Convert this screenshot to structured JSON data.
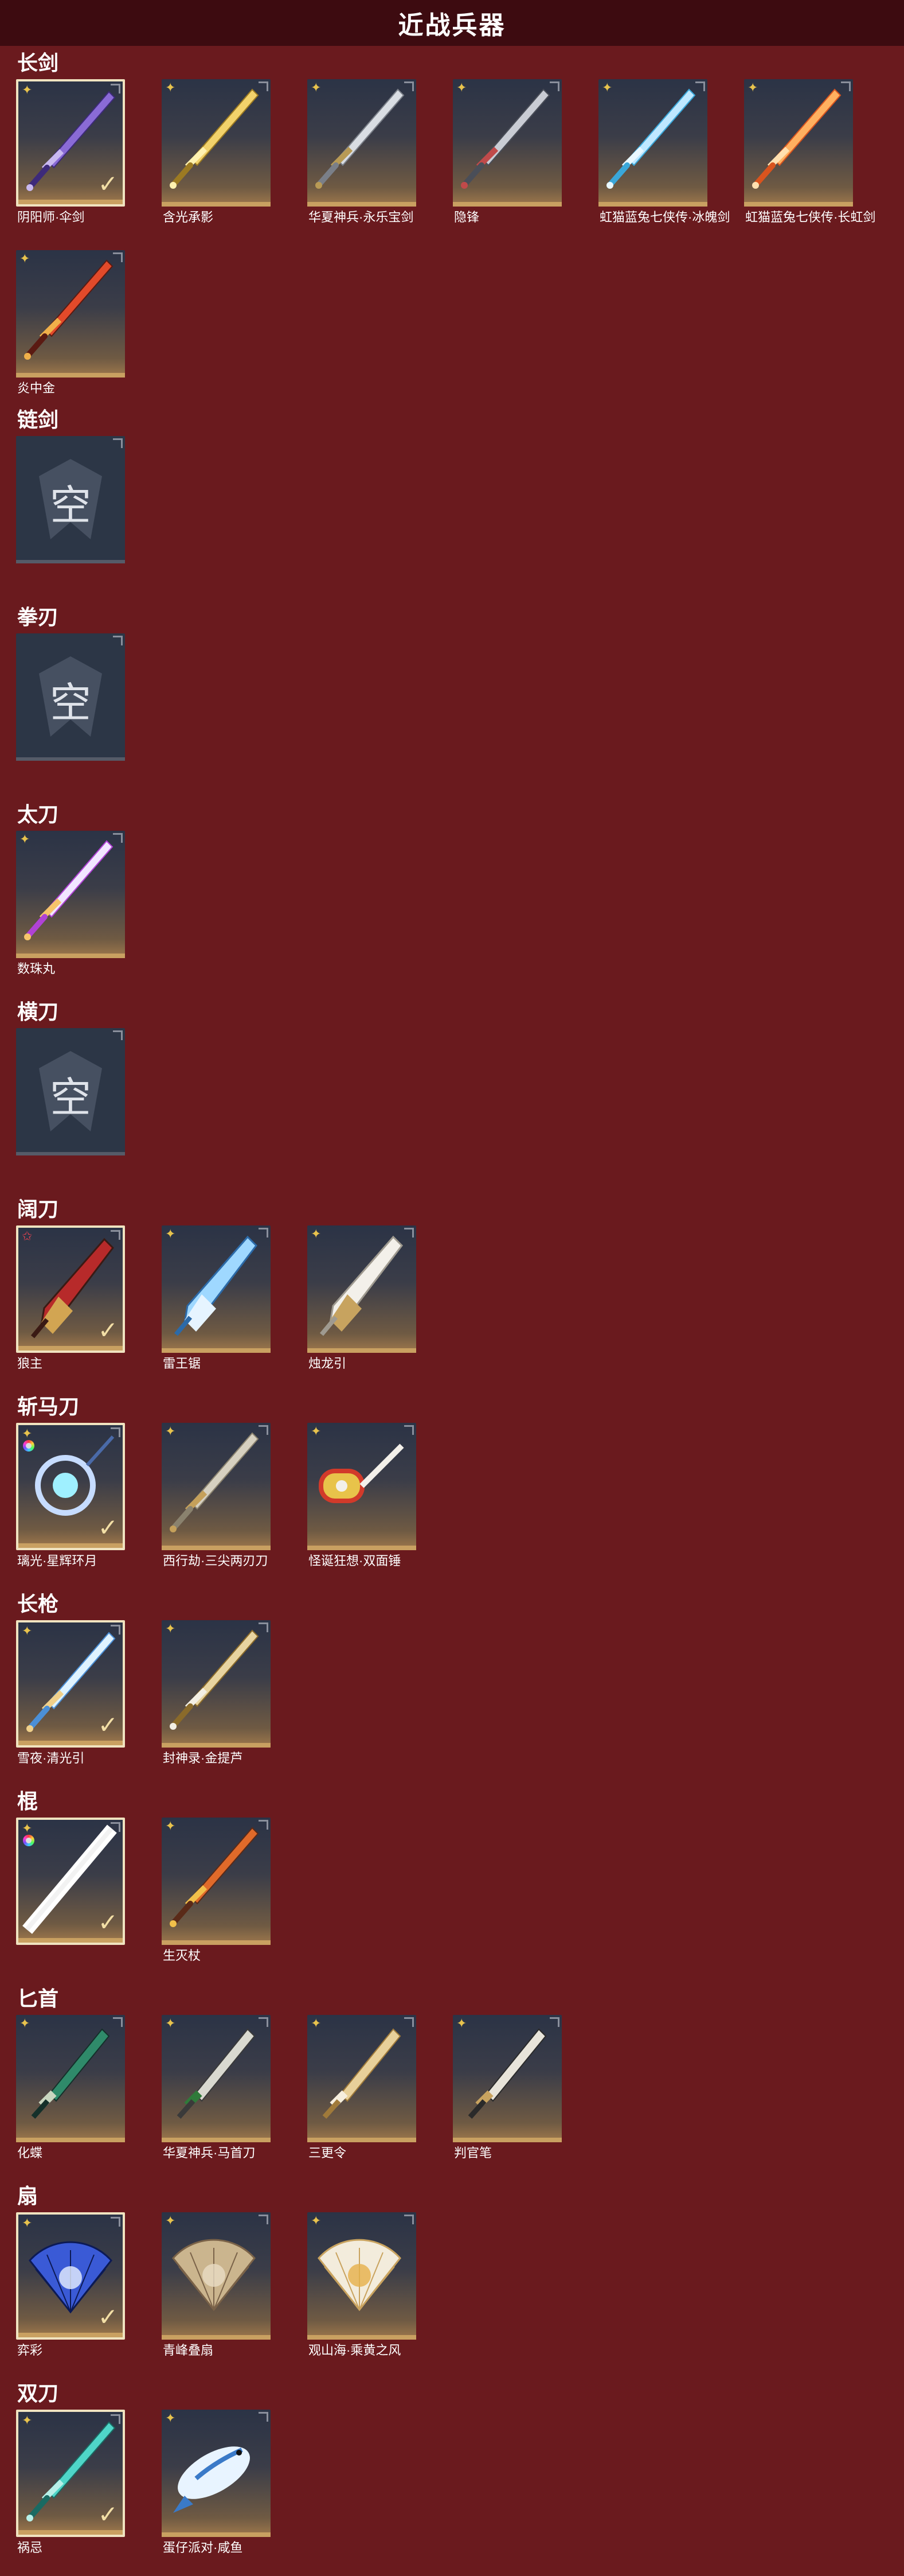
{
  "header": {
    "title": "近战兵器"
  },
  "sections": [
    {
      "title": "长剑",
      "items": [
        {
          "name": "阴阳师·伞剑",
          "selected": true,
          "rarity": "star",
          "weapon": "sword-purple"
        },
        {
          "name": "含光承影",
          "rarity": "star",
          "weapon": "sword-gold"
        },
        {
          "name": "华夏神兵·永乐宝剑",
          "rarity": "star",
          "weapon": "sword-silver"
        },
        {
          "name": "隐锋",
          "rarity": "star",
          "weapon": "sword-dark"
        },
        {
          "name": "虹猫蓝兔七侠传·冰魄剑",
          "rarity": "star",
          "weapon": "sword-ice"
        },
        {
          "name": "虹猫蓝兔七侠传·长虹剑",
          "rarity": "star",
          "weapon": "sword-orange"
        },
        {
          "name": "炎中金",
          "rarity": "star",
          "weapon": "sword-flame"
        }
      ]
    },
    {
      "title": "链剑",
      "items": [
        {
          "name": "",
          "empty": true,
          "empty_label": "空"
        }
      ]
    },
    {
      "title": "拳刃",
      "items": [
        {
          "name": "",
          "empty": true,
          "empty_label": "空"
        }
      ]
    },
    {
      "title": "太刀",
      "items": [
        {
          "name": "数珠丸",
          "rarity": "star",
          "weapon": "katana"
        }
      ]
    },
    {
      "title": "横刀",
      "items": [
        {
          "name": "",
          "empty": true,
          "empty_label": "空"
        }
      ]
    },
    {
      "title": "阔刀",
      "items": [
        {
          "name": "狼主",
          "selected": true,
          "rarity": "pink-star",
          "weapon": "broad-red"
        },
        {
          "name": "雷王锯",
          "rarity": "star",
          "weapon": "broad-blue"
        },
        {
          "name": "烛龙引",
          "rarity": "star",
          "weapon": "broad-white"
        }
      ]
    },
    {
      "title": "斩马刀",
      "items": [
        {
          "name": "璃光·星辉环月",
          "selected": true,
          "rarity": "star",
          "ring": true,
          "weapon": "moon-blade"
        },
        {
          "name": "西行劫·三尖两刃刀",
          "rarity": "star",
          "weapon": "trident"
        },
        {
          "name": "怪诞狂想·双面锤",
          "rarity": "star",
          "weapon": "hammer"
        }
      ]
    },
    {
      "title": "长枪",
      "items": [
        {
          "name": "雪夜·清光引",
          "selected": true,
          "rarity": "star",
          "weapon": "spear-ice"
        },
        {
          "name": "封神录·金提芦",
          "rarity": "star",
          "weapon": "spear-gold"
        }
      ]
    },
    {
      "title": "棍",
      "items": [
        {
          "name": "",
          "selected": true,
          "rarity": "star",
          "ring": true,
          "weapon": "staff-white"
        },
        {
          "name": "生灭杖",
          "rarity": "star",
          "weapon": "staff-flame"
        }
      ]
    },
    {
      "title": "匕首",
      "items": [
        {
          "name": "化蝶",
          "rarity": "star",
          "weapon": "dagger-jade"
        },
        {
          "name": "华夏神兵·马首刀",
          "rarity": "star",
          "weapon": "dagger-horse"
        },
        {
          "name": "三更令",
          "rarity": "star",
          "weapon": "dagger-gold"
        },
        {
          "name": "判官笔",
          "rarity": "star",
          "weapon": "brush"
        }
      ]
    },
    {
      "title": "扇",
      "items": [
        {
          "name": "弈彩",
          "selected": true,
          "rarity": "star",
          "weapon": "fan-blue"
        },
        {
          "name": "青峰叠扇",
          "rarity": "star",
          "weapon": "fan-wood"
        },
        {
          "name": "观山海·乘黄之风",
          "rarity": "star",
          "weapon": "fan-white"
        }
      ]
    },
    {
      "title": "双刀",
      "items": [
        {
          "name": "祸忌",
          "selected": true,
          "rarity": "star",
          "weapon": "twin-jade"
        },
        {
          "name": "蛋仔派对·咸鱼",
          "rarity": "star",
          "weapon": "fish"
        }
      ]
    }
  ]
}
